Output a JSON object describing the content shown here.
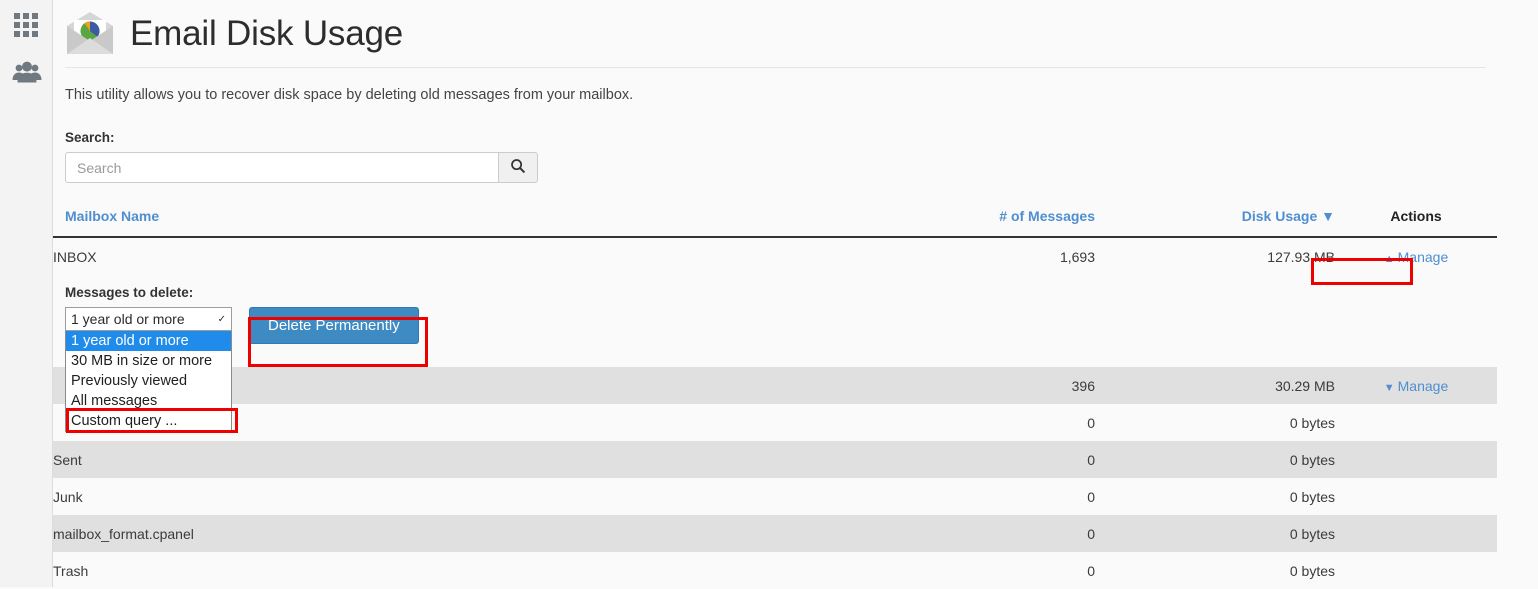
{
  "sidebar": {
    "items": [
      {
        "name": "apps-grid",
        "icon": "grid-icon"
      },
      {
        "name": "user-manager",
        "icon": "users-icon"
      }
    ]
  },
  "header": {
    "title": "Email Disk Usage",
    "icon": "email-pie-chart-icon"
  },
  "intro": {
    "text": "This utility allows you to recover disk space by deleting old messages from your mailbox."
  },
  "search": {
    "label": "Search:",
    "value": "",
    "placeholder": "Search",
    "button_icon": "search-icon"
  },
  "table": {
    "headers": {
      "name": "Mailbox Name",
      "count": "# of Messages",
      "usage": "Disk Usage ▼",
      "actions": "Actions"
    },
    "sort": {
      "column": "Disk Usage",
      "direction": "desc",
      "indicator": "▼"
    },
    "rows": [
      {
        "name": "INBOX",
        "count": "1,693",
        "usage": "127.93 MB",
        "action": "Manage",
        "caret": "⌃",
        "expanded": true
      },
      {
        "name": "",
        "count": "396",
        "usage": "30.29 MB",
        "action": "Manage",
        "caret": "⌄",
        "expanded": false
      },
      {
        "name": "",
        "count": "0",
        "usage": "0 bytes",
        "action": "",
        "caret": "",
        "expanded": false
      },
      {
        "name": "Sent",
        "count": "0",
        "usage": "0 bytes",
        "action": "",
        "caret": "",
        "expanded": false
      },
      {
        "name": "Junk",
        "count": "0",
        "usage": "0 bytes",
        "action": "",
        "caret": "",
        "expanded": false
      },
      {
        "name": "mailbox_format.cpanel",
        "count": "0",
        "usage": "0 bytes",
        "action": "",
        "caret": "",
        "expanded": false
      },
      {
        "name": "Trash",
        "count": "0",
        "usage": "0 bytes",
        "action": "",
        "caret": "",
        "expanded": false
      }
    ]
  },
  "expanded_panel": {
    "label": "Messages to delete:",
    "selected_value": "1 year old or more",
    "options": [
      "1 year old or more",
      "30 MB in size or more",
      "Previously viewed",
      "All messages",
      "Custom query ..."
    ],
    "delete_button": "Delete Permanently"
  },
  "colors": {
    "link": "#4f8ed0",
    "button_primary": "#3e8bc4",
    "annotation": "#ee0000",
    "option_highlight": "#1f8ceb",
    "row_alt": "#e0e0e0",
    "row_plain": "#fafafa",
    "sidebar_bg": "#f3f3f3"
  }
}
